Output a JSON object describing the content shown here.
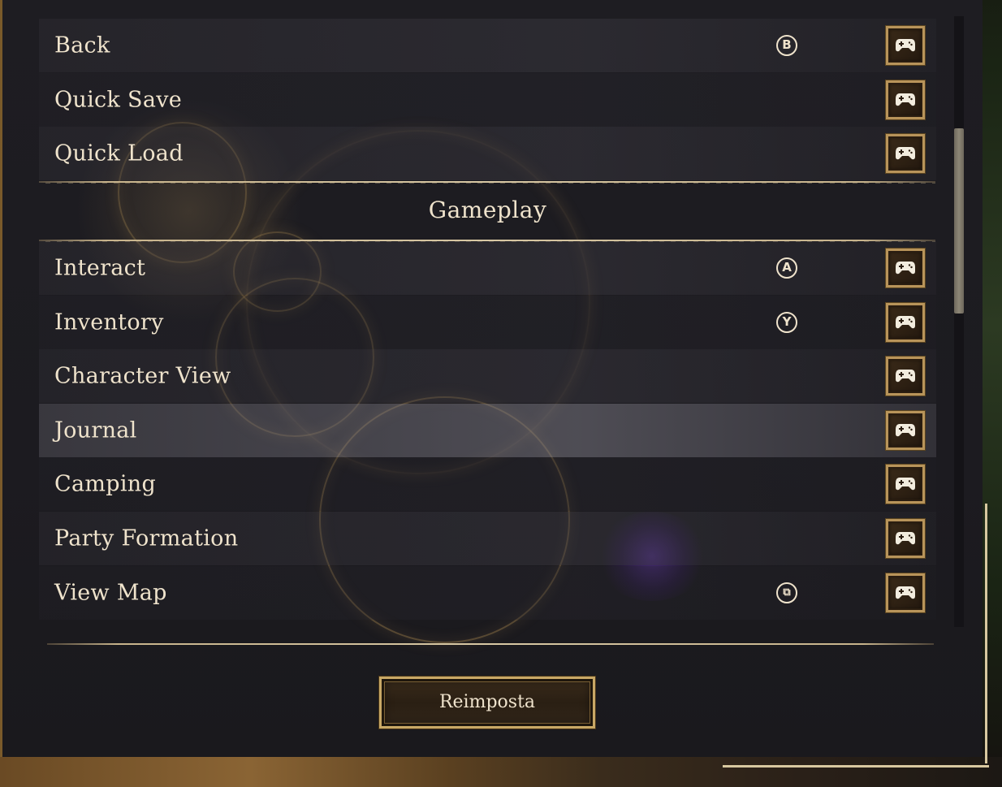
{
  "rows_top": [
    {
      "label": "Back",
      "button": "B",
      "has_button": true
    },
    {
      "label": "Quick Save",
      "button": "",
      "has_button": false
    },
    {
      "label": "Quick Load",
      "button": "",
      "has_button": false
    }
  ],
  "section": {
    "title": "Gameplay"
  },
  "rows_gameplay": [
    {
      "label": "Interact",
      "button": "A",
      "has_button": true
    },
    {
      "label": "Inventory",
      "button": "Y",
      "has_button": true
    },
    {
      "label": "Character View",
      "button": "",
      "has_button": false
    },
    {
      "label": "Journal",
      "button": "",
      "has_button": false,
      "selected": true
    },
    {
      "label": "Camping",
      "button": "",
      "has_button": false
    },
    {
      "label": "Party Formation",
      "button": "",
      "has_button": false
    },
    {
      "label": "View Map",
      "button": "⧉",
      "has_button": true
    }
  ],
  "icons": {
    "controller": "gamepad-icon",
    "face_button": "controller-button-icon"
  },
  "colors": {
    "text": "#efe3cc",
    "gold_border": "#b8945a",
    "panel": "#1e1d22",
    "selected_row": "#6e6c76"
  },
  "scrollbar": {
    "position_fraction": 0.18
  },
  "footer": {
    "reset_label": "Reimposta"
  }
}
